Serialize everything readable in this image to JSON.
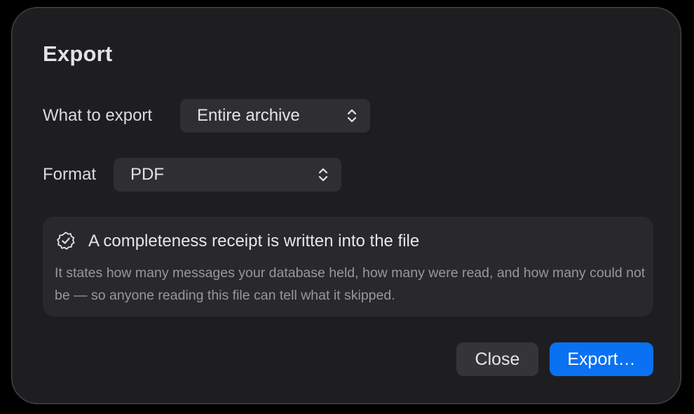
{
  "dialog": {
    "title": "Export"
  },
  "what_to_export": {
    "label": "What to export",
    "selected": "Entire archive"
  },
  "format": {
    "label": "Format",
    "selected": "PDF"
  },
  "receipt": {
    "icon": "verified-badge-icon",
    "title": "A completeness receipt is written into the file",
    "body": "It states how many messages your database held, how many were read, and how many could not be — so anyone reading this file can tell what it skipped."
  },
  "buttons": {
    "close_label": "Close",
    "export_label": "Export…"
  },
  "colors": {
    "accent": "#0a71f2",
    "background": "#1e1e20"
  }
}
